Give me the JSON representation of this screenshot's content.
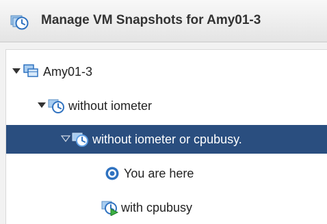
{
  "dialog": {
    "title": "Manage VM Snapshots for Amy01-3",
    "icon": "snapshot-clock-icon"
  },
  "tree": {
    "nodes": [
      {
        "label": "Amy01-3",
        "icon": "virtual-machine-icon",
        "expanded": true,
        "selected": false
      },
      {
        "label": "without iometer",
        "icon": "snapshot-clock-icon",
        "expanded": true,
        "selected": false
      },
      {
        "label": "without iometer or cpubusy.",
        "icon": "snapshot-clock-icon",
        "expanded": true,
        "selected": true
      },
      {
        "label": "You are here",
        "icon": "current-state-target-icon",
        "expanded": false,
        "selected": false
      },
      {
        "label": "with cpubusy",
        "icon": "snapshot-running-icon",
        "expanded": false,
        "selected": false
      }
    ]
  },
  "colors": {
    "selection": "#2a4e7f",
    "icon_blue": "#3d7ec9"
  }
}
